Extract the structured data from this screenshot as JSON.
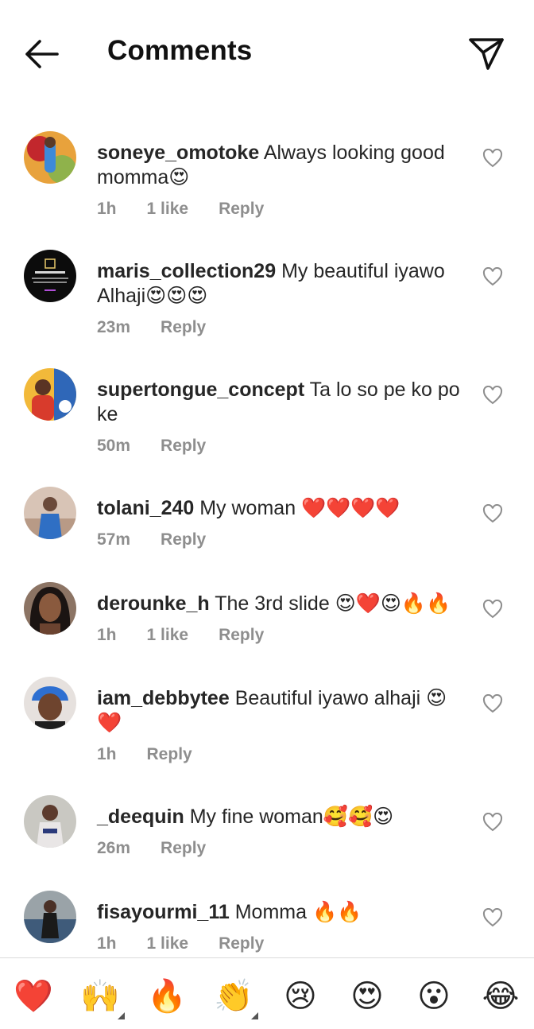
{
  "header": {
    "title": "Comments"
  },
  "comments": [
    {
      "user": "soneye_omotoke",
      "text": "Always looking good momma😍",
      "time": "1h",
      "likes": "1 like",
      "reply": "Reply"
    },
    {
      "user": "maris_collection29",
      "text": "My beautiful iyawo Alhaji😍😍😍",
      "time": "23m",
      "likes": "",
      "reply": "Reply"
    },
    {
      "user": "supertongue_concept",
      "text": "Ta lo so pe ko po ke",
      "time": "50m",
      "likes": "",
      "reply": "Reply"
    },
    {
      "user": "tolani_240",
      "text": "My woman ❤️❤️❤️❤️",
      "time": "57m",
      "likes": "",
      "reply": "Reply"
    },
    {
      "user": "derounke_h",
      "text": "The 3rd slide 😍❤️😍🔥🔥",
      "time": "1h",
      "likes": "1 like",
      "reply": "Reply"
    },
    {
      "user": "iam_debbytee",
      "text": "Beautiful iyawo alhaji 😍❤️",
      "time": "1h",
      "likes": "",
      "reply": "Reply"
    },
    {
      "user": "_deequin",
      "text": "My fine woman🥰🥰😍",
      "time": "26m",
      "likes": "",
      "reply": "Reply"
    },
    {
      "user": "fisayourmi_11",
      "text": "Momma 🔥🔥",
      "time": "1h",
      "likes": "1 like",
      "reply": "Reply"
    }
  ],
  "reactions": [
    "❤️",
    "🙌",
    "🔥",
    "👏",
    "😢",
    "😍",
    "😮",
    "😂"
  ],
  "colors": {
    "text": "#262626",
    "meta": "#8e8e8e",
    "divider": "#dbdbdb"
  }
}
